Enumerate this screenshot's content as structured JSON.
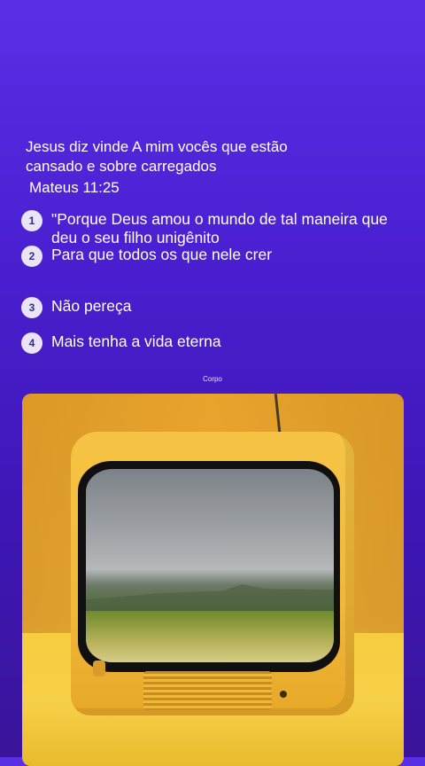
{
  "intro": {
    "line1": "Jesus diz vinde A mim vocês que estão",
    "line2": "cansado e sobre carregados",
    "reference": "Mateus 11:25"
  },
  "steps": [
    {
      "number": "1",
      "text": "\"Porque Deus amou o mundo de tal maneira que deu o seu filho unigênito"
    },
    {
      "number": "2",
      "text": "Para que todos os que nele crer"
    },
    {
      "number": "3",
      "text": "Não pereça"
    },
    {
      "number": "4",
      "text": "Mais tenha a vida eterna"
    }
  ],
  "caption": "Corpo",
  "image": {
    "icon": "retro-tv-landscape-photo"
  },
  "colors": {
    "background_top": "#5a2fe6",
    "background_bottom": "#3a1499",
    "badge": "#e9e4f7",
    "photo_wall": "#e8a530"
  }
}
